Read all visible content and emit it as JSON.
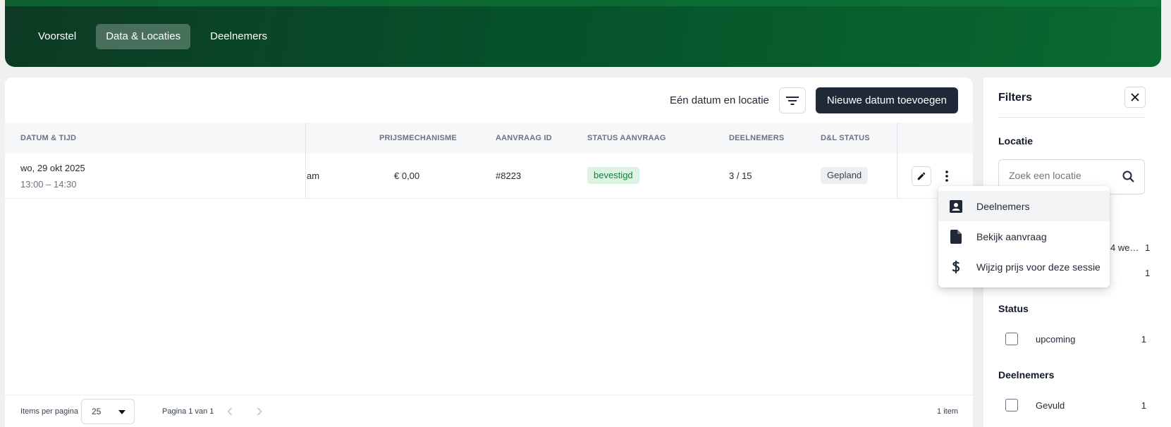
{
  "header": {
    "tabs": [
      {
        "label": "Voorstel",
        "active": false
      },
      {
        "label": "Data & Locaties",
        "active": true
      },
      {
        "label": "Deelnemers",
        "active": false
      }
    ]
  },
  "toolbar": {
    "mode_label": "Eén datum en locatie",
    "filter_icon": "filter-icon",
    "add_button": "Nieuwe datum toevoegen"
  },
  "table": {
    "columns": {
      "datetime": "DATUM & TIJD",
      "price": "PRIJSMECHANISME",
      "request_id": "AANVRAAG ID",
      "request_status": "STATUS AANVRAAG",
      "participants": "DEELNEMERS",
      "dl_status": "D&L STATUS"
    },
    "row": {
      "date": "wo, 29 okt 2025",
      "time": "13:00 – 14:30",
      "location_partial": "am",
      "price": "€ 0,00",
      "request_id": "#8223",
      "request_status": "bevestigd",
      "participants": "3 / 15",
      "dl_status": "Gepland"
    }
  },
  "footer": {
    "per_page_label": "Items per pagina",
    "per_page_value": "25",
    "page_label": "Pagina 1 van 1",
    "total": "1 item"
  },
  "filters": {
    "title": "Filters",
    "location": {
      "title": "Locatie",
      "placeholder": "Zoek een locatie",
      "partial_item": "4 we…",
      "partial_count_1": "1",
      "partial_count_2": "1"
    },
    "status": {
      "title": "Status",
      "items": [
        {
          "label": "upcoming",
          "count": "1"
        }
      ]
    },
    "participants": {
      "title": "Deelnemers",
      "items": [
        {
          "label": "Gevuld",
          "count": "1"
        }
      ]
    }
  },
  "context_menu": {
    "items": [
      {
        "label": "Deelnemers",
        "icon": "contact-icon"
      },
      {
        "label": "Bekijk aanvraag",
        "icon": "document-icon"
      },
      {
        "label": "Wijzig prijs voor deze sessie",
        "icon": "dollar-icon"
      }
    ]
  },
  "colors": {
    "header_start": "#0d3a24",
    "header_end": "#0a6a30",
    "primary_button": "#1f2937",
    "success_badge_bg": "#ddf3e4",
    "success_badge_text": "#15803d"
  }
}
